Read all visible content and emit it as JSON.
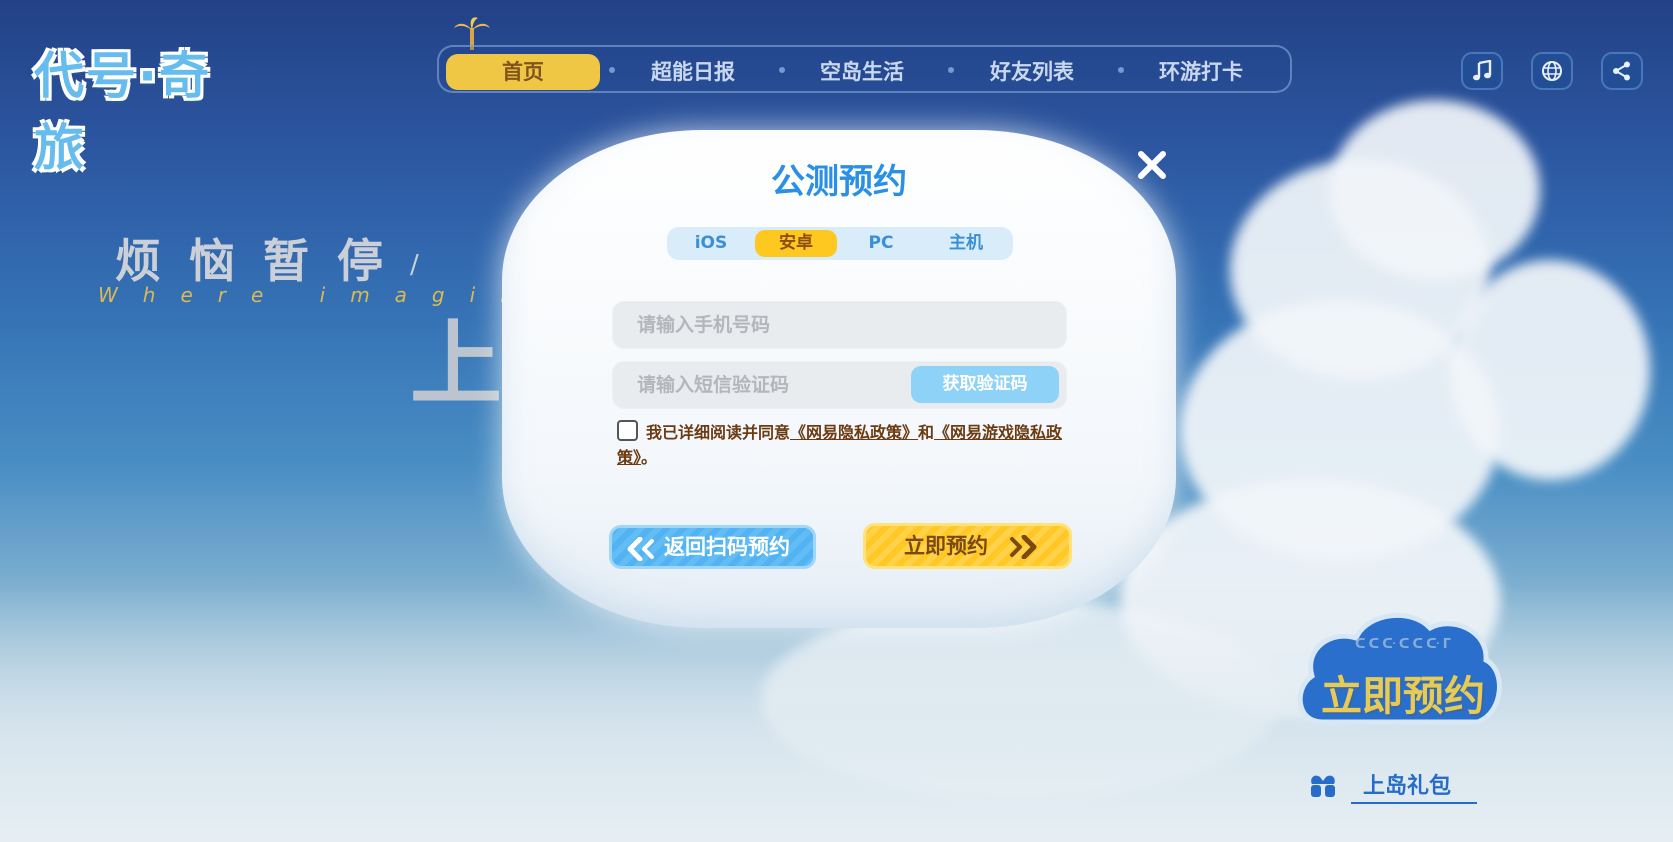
{
  "logo": {
    "text": "代号·奇旅"
  },
  "nav": {
    "items": [
      {
        "label": "首页",
        "active": true
      },
      {
        "label": "超能日报",
        "active": false
      },
      {
        "label": "空岛生活",
        "active": false
      },
      {
        "label": "好友列表",
        "active": false
      },
      {
        "label": "环游打卡",
        "active": false
      }
    ]
  },
  "top_buttons": {
    "music_icon": "music-icon",
    "language_icon": "globe-icon",
    "share_icon": "share-icon"
  },
  "hero": {
    "title_cn": "烦恼暂停",
    "slash": "/",
    "title_en": "Where imaginat",
    "big_text": "上岛"
  },
  "cta": {
    "sub": "ᑕᑕᑢᑕᑕᑢᒥ",
    "label": "立即预约"
  },
  "gift": {
    "label": "上岛礼包"
  },
  "modal": {
    "title": "公测预约",
    "tabs": [
      {
        "label": "iOS",
        "active": false
      },
      {
        "label": "安卓",
        "active": true
      },
      {
        "label": "PC",
        "active": false
      },
      {
        "label": "主机",
        "active": false
      }
    ],
    "phone_placeholder": "请输入手机号码",
    "code_placeholder": "请输入短信验证码",
    "get_code_label": "获取验证码",
    "agree_prefix": "我已详细阅读并同意",
    "policy1": "《网易隐私政策》",
    "agree_and": "和",
    "policy2": "《网易游戏隐私政策》",
    "agree_suffix": "。",
    "back_label": "返回扫码预约",
    "reserve_label": "立即预约"
  },
  "colors": {
    "accent_blue": "#2a8fe6",
    "accent_yellow": "#ffc820",
    "brown_text": "#6b3b12"
  }
}
